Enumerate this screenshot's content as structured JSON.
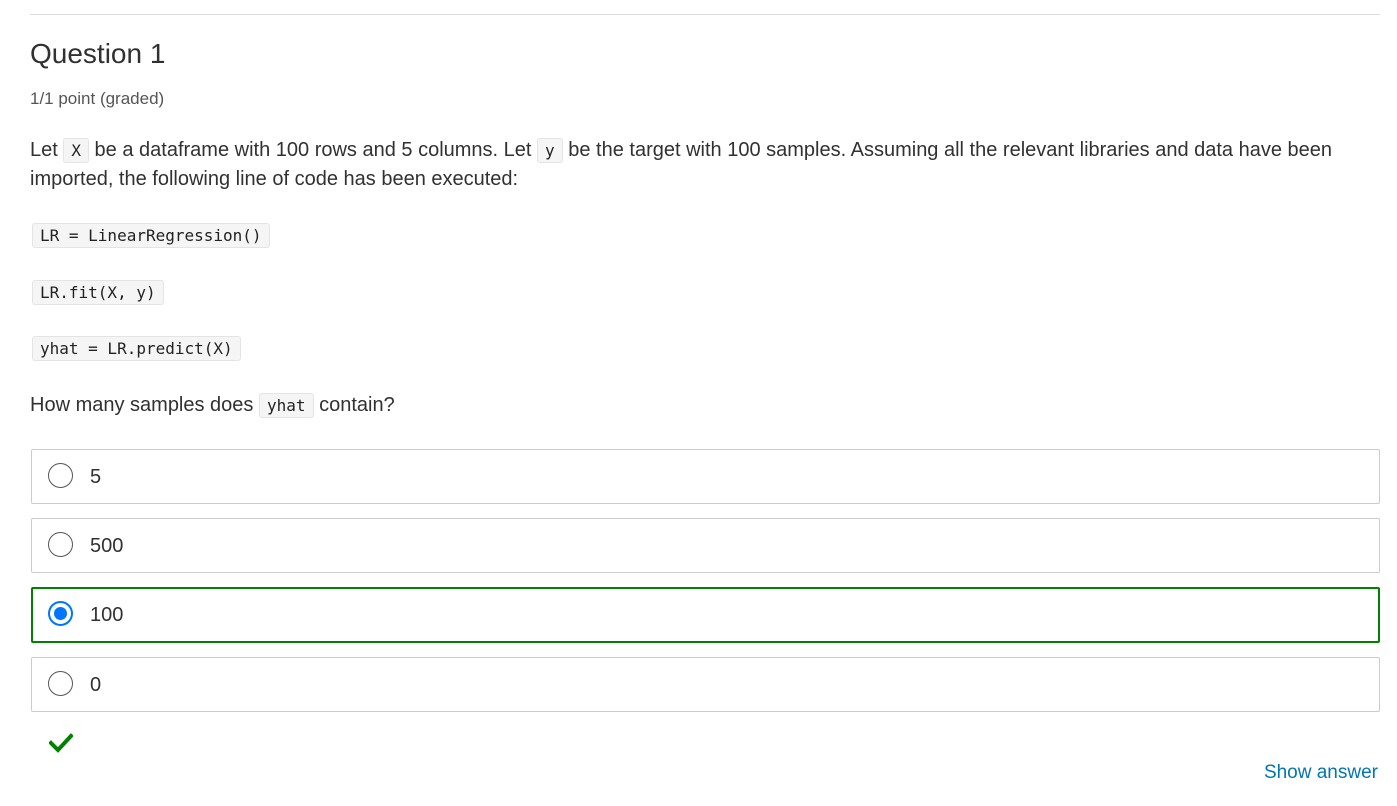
{
  "question": {
    "title": "Question 1",
    "points": "1/1 point (graded)",
    "prompt_parts": [
      "Let ",
      "X",
      " be a dataframe with 100 rows and 5 columns. Let ",
      "y",
      " be the target with 100 samples. Assuming all the relevant libraries and data have been imported, the following line of code has been executed:"
    ],
    "code_lines": [
      "LR = LinearRegression()",
      "LR.fit(X, y)",
      "yhat = LR.predict(X)"
    ],
    "ask_parts": [
      "How many samples does ",
      "yhat",
      " contain?"
    ]
  },
  "choices": [
    {
      "label": "5",
      "selected": false
    },
    {
      "label": "500",
      "selected": false
    },
    {
      "label": "100",
      "selected": true
    },
    {
      "label": "0",
      "selected": false
    }
  ],
  "result": {
    "status_icon": "checkmark-icon",
    "status": "correct"
  },
  "actions": {
    "show_answer_label": "Show answer"
  },
  "colors": {
    "correct_border": "#008100",
    "radio_selected": "#0075ff",
    "link": "#0075b4",
    "check": "#008100"
  }
}
